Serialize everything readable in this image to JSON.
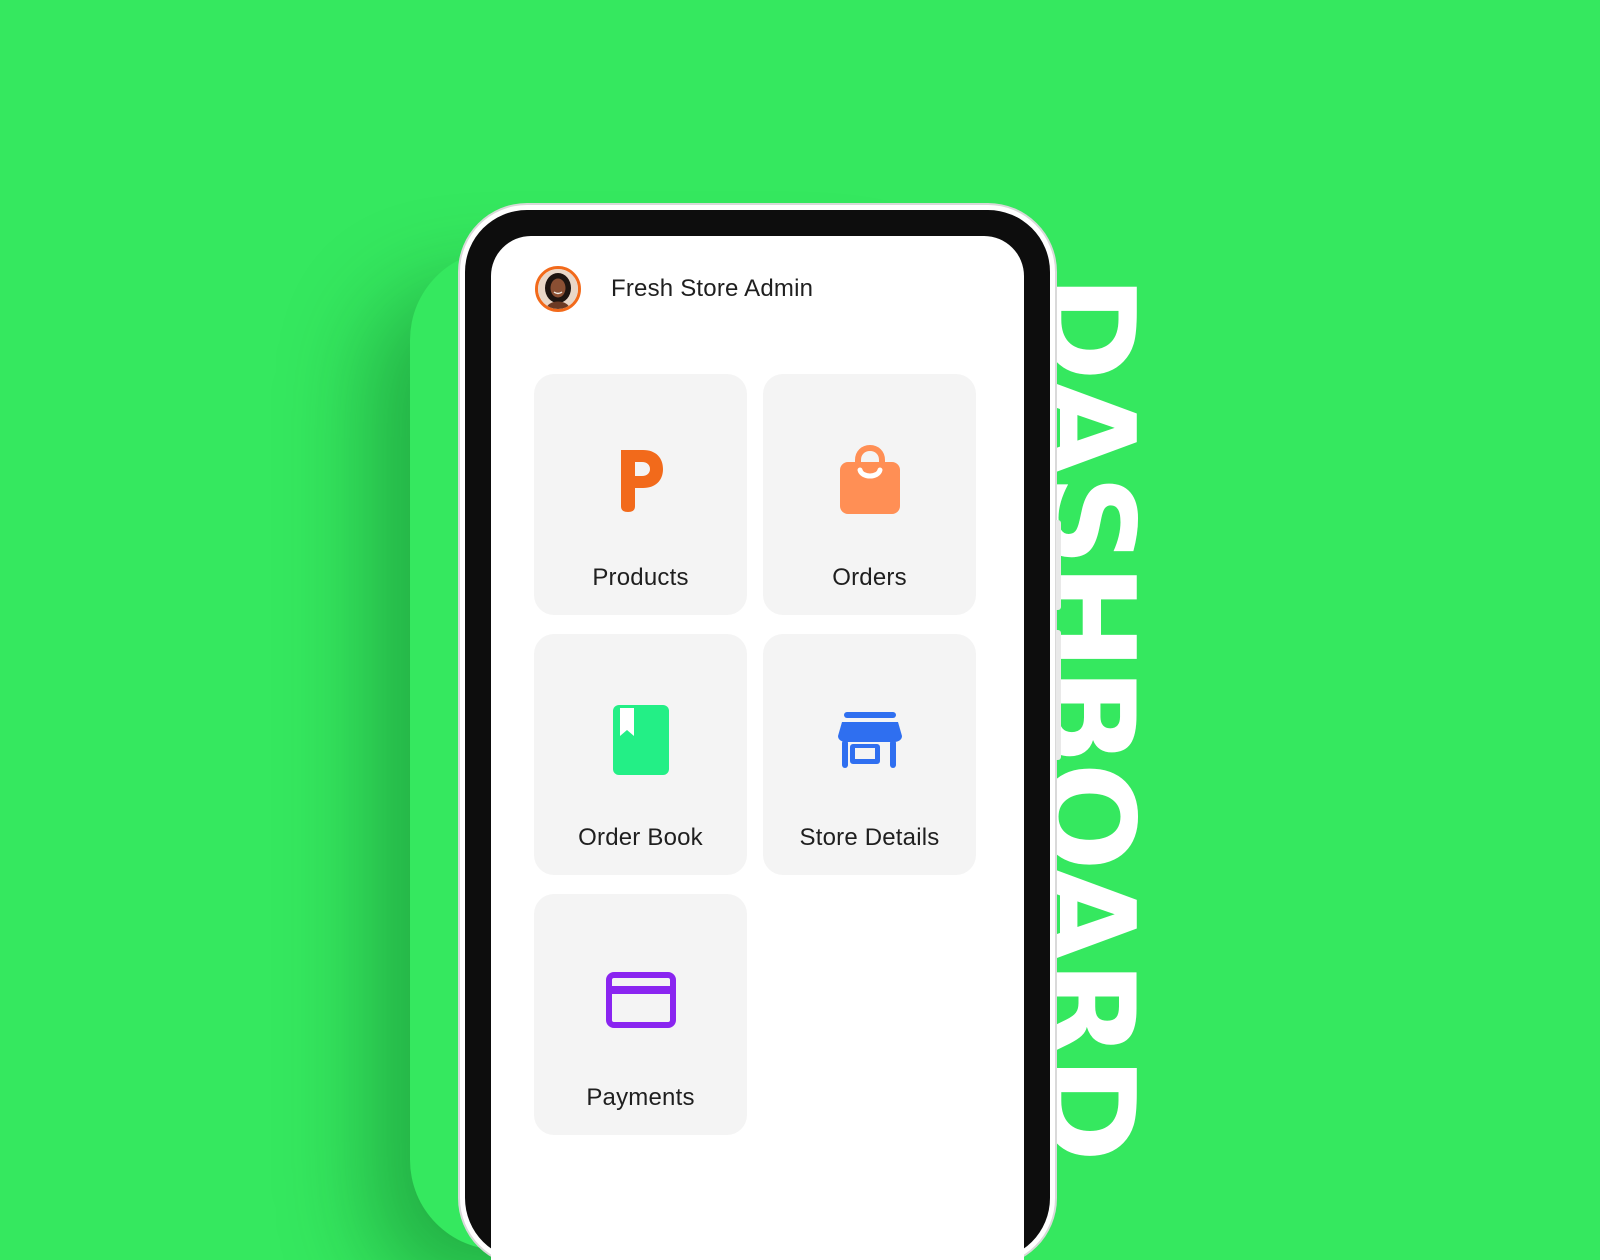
{
  "banner": {
    "title": "DASHBOARD"
  },
  "header": {
    "admin_name": "Fresh Store Admin",
    "avatar_icon": "user-avatar"
  },
  "tiles": [
    {
      "label": "Products",
      "icon": "product-p-icon",
      "color": "#f26a1b"
    },
    {
      "label": "Orders",
      "icon": "shopping-bag-icon",
      "color": "#ff8f55"
    },
    {
      "label": "Order Book",
      "icon": "bookmark-book-icon",
      "color": "#23ef86"
    },
    {
      "label": "Store Details",
      "icon": "storefront-icon",
      "color": "#2f6ff0"
    },
    {
      "label": "Payments",
      "icon": "credit-card-icon",
      "color": "#8a25f0"
    }
  ],
  "colors": {
    "background": "#35e85f",
    "tile_background": "#f4f4f4",
    "avatar_ring": "#f26a1b"
  }
}
